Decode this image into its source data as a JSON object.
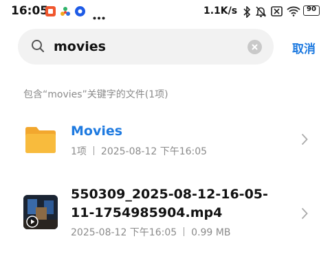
{
  "status_bar": {
    "time": "16:05",
    "net_speed": "1.1K/s",
    "battery": "90",
    "icons": [
      "app-notification-icon",
      "colorful-app-icon",
      "blue-app-icon",
      "more-dots-icon",
      "bluetooth-icon",
      "mute-bell-icon",
      "sim-off-icon",
      "wifi-icon",
      "battery-icon"
    ]
  },
  "search": {
    "query": "movies",
    "cancel_label": "取消"
  },
  "results": {
    "summary": "包含“movies”关键字的文件(1项)",
    "items": [
      {
        "kind": "folder",
        "title": "Movies",
        "count": "1项",
        "date": "2025-08-12 下午16:05"
      },
      {
        "kind": "video",
        "title": "550309_2025-08-12-16-05-11-1754985904.mp4",
        "date": "2025-08-12 下午16:05",
        "size": "0.99 MB"
      }
    ]
  },
  "colors": {
    "accent": "#1e7ae0",
    "folder": "#f7b733",
    "secondary_text": "#8a8a8a",
    "search_bg": "#f2f2f2"
  }
}
